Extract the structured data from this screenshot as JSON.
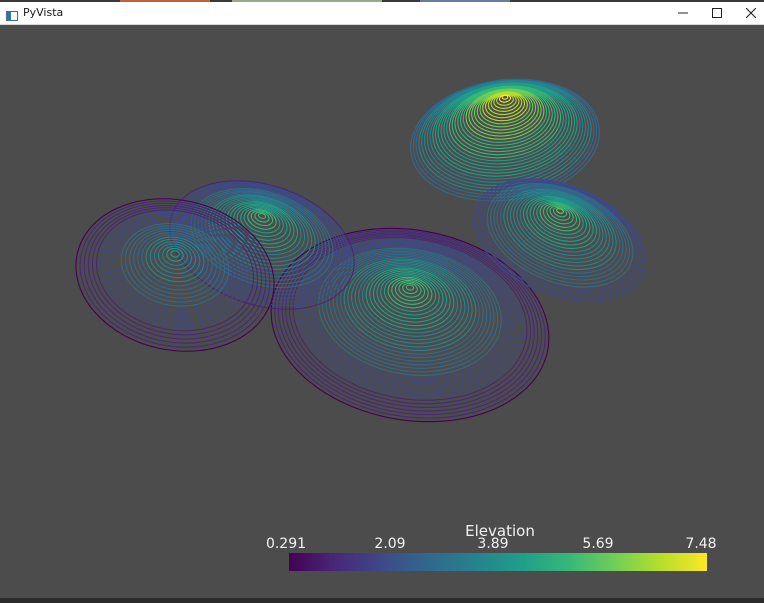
{
  "window": {
    "title": "PyVista",
    "app_icon": "pyvista-window-icon",
    "controls": [
      "minimize-icon",
      "maximize-icon",
      "close-icon"
    ]
  },
  "scene": {
    "background": "#4c4c4c",
    "colormap": "viridis"
  },
  "colorbar": {
    "title": "Elevation",
    "ticks": [
      "0.291",
      "2.09",
      "3.89",
      "5.69",
      "7.48"
    ],
    "min": 0.291,
    "max": 7.48
  }
}
